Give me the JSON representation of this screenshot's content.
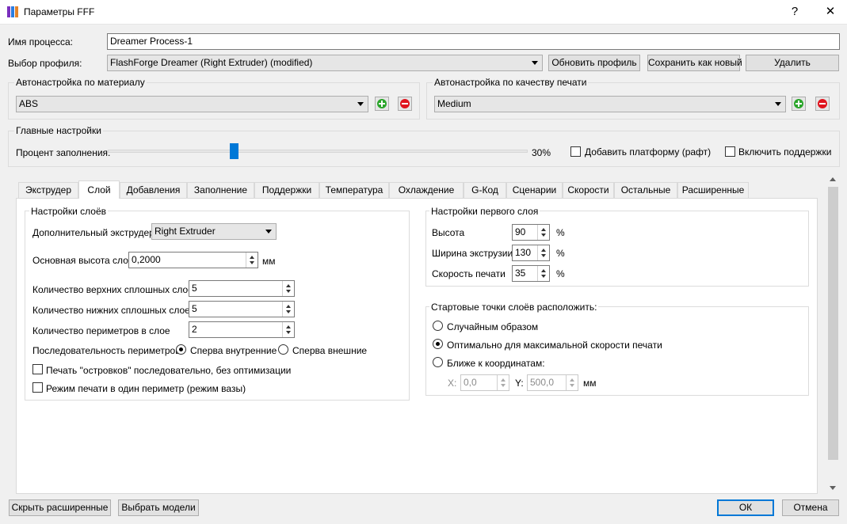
{
  "window": {
    "title": "Параметры FFF",
    "help_label": "?",
    "close_label": "✕"
  },
  "process": {
    "label": "Имя процесса:",
    "value": "Dreamer Process-1"
  },
  "profile": {
    "label": "Выбор профиля:",
    "selected": "FlashForge Dreamer (Right Extruder) (modified)",
    "update_label": "Обновить профиль",
    "save_new_label": "Сохранить как новый",
    "delete_label": "Удалить"
  },
  "material": {
    "title": "Автонастройка по  материалу",
    "selected": "ABS"
  },
  "quality": {
    "title": "Автонастройка по качеству печати",
    "selected": "Medium"
  },
  "main_settings": {
    "title": "Главные настройки",
    "infill_label": "Процент заполнения:",
    "infill_value": "30%",
    "infill_fraction": 0.3,
    "raft_label": "Добавить платформу (рафт)",
    "supports_label": "Включить поддержки"
  },
  "tabs": [
    "Экструдер",
    "Слой",
    "Добавления",
    "Заполнение",
    "Поддержки",
    "Температура",
    "Охлаждение",
    "G-Код",
    "Сценарии",
    "Скорости",
    "Остальные",
    "Расширенные"
  ],
  "active_tab": "Слой",
  "layer": {
    "title": "Настройки слоёв",
    "extra_extruder_label": "Дополнительный экструдер",
    "extra_extruder_value": "Right Extruder",
    "layer_height_label": "Основная высота слоя",
    "layer_height_value": "0,2000",
    "layer_height_unit": "мм",
    "top_layers_label": "Количество верхних сплошных слоёв",
    "top_layers_value": "5",
    "bottom_layers_label": "Количество нижних сплошных слоев",
    "bottom_layers_value": "5",
    "perimeters_label": "Количество периметров в слое",
    "perimeters_value": "2",
    "sequence_label": "Последовательность периметров:",
    "sequence_inner": "Сперва внутренние",
    "sequence_outer": "Сперва внешние",
    "islands_label": "Печать \"островков\" последовательно, без оптимизации",
    "vase_label": "Режим печати в один периметр (режим вазы)"
  },
  "first_layer": {
    "title": "Настройки первого слоя",
    "height_label": "Высота",
    "height_value": "90",
    "height_unit": "%",
    "width_label": "Ширина экструзии",
    "width_value": "130",
    "width_unit": "%",
    "speed_label": "Скорость печати",
    "speed_value": "35",
    "speed_unit": "%"
  },
  "start_points": {
    "title": "Стартовые точки слоёв расположить:",
    "random_label": "Случайным образом",
    "optimal_label": "Оптимально для максимальной скорости печати",
    "nearest_label": "Ближе к координатам:",
    "x_label": "X:",
    "x_value": "0,0",
    "y_label": "Y:",
    "y_value": "500,0",
    "unit": "мм"
  },
  "footer": {
    "hide_advanced_label": "Скрыть расширенные",
    "select_models_label": "Выбрать модели",
    "ok_label": "ОК",
    "cancel_label": "Отмена"
  },
  "colors": {
    "accent": "#0078d7",
    "add": "#2aa52a",
    "remove": "#e0141e"
  }
}
